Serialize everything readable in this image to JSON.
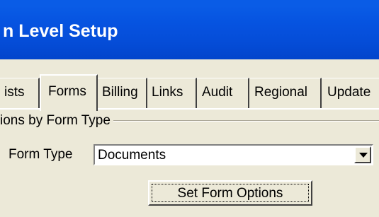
{
  "window": {
    "title": "n Level Setup"
  },
  "tabs": [
    {
      "label": "ists"
    },
    {
      "label": "Forms",
      "selected": true
    },
    {
      "label": "Billing"
    },
    {
      "label": "Links"
    },
    {
      "label": "Audit"
    },
    {
      "label": "Regional"
    },
    {
      "label": "Update"
    }
  ],
  "group": {
    "title": "ions by Form Type"
  },
  "form_type": {
    "label": "Form Type",
    "value": "Documents"
  },
  "set_form_options_button": {
    "label": "Set Form Options"
  },
  "icons": {
    "dropdown": "triangle-down-icon"
  },
  "colors": {
    "title_bar": "#0653e0",
    "face": "#ece9d8"
  }
}
